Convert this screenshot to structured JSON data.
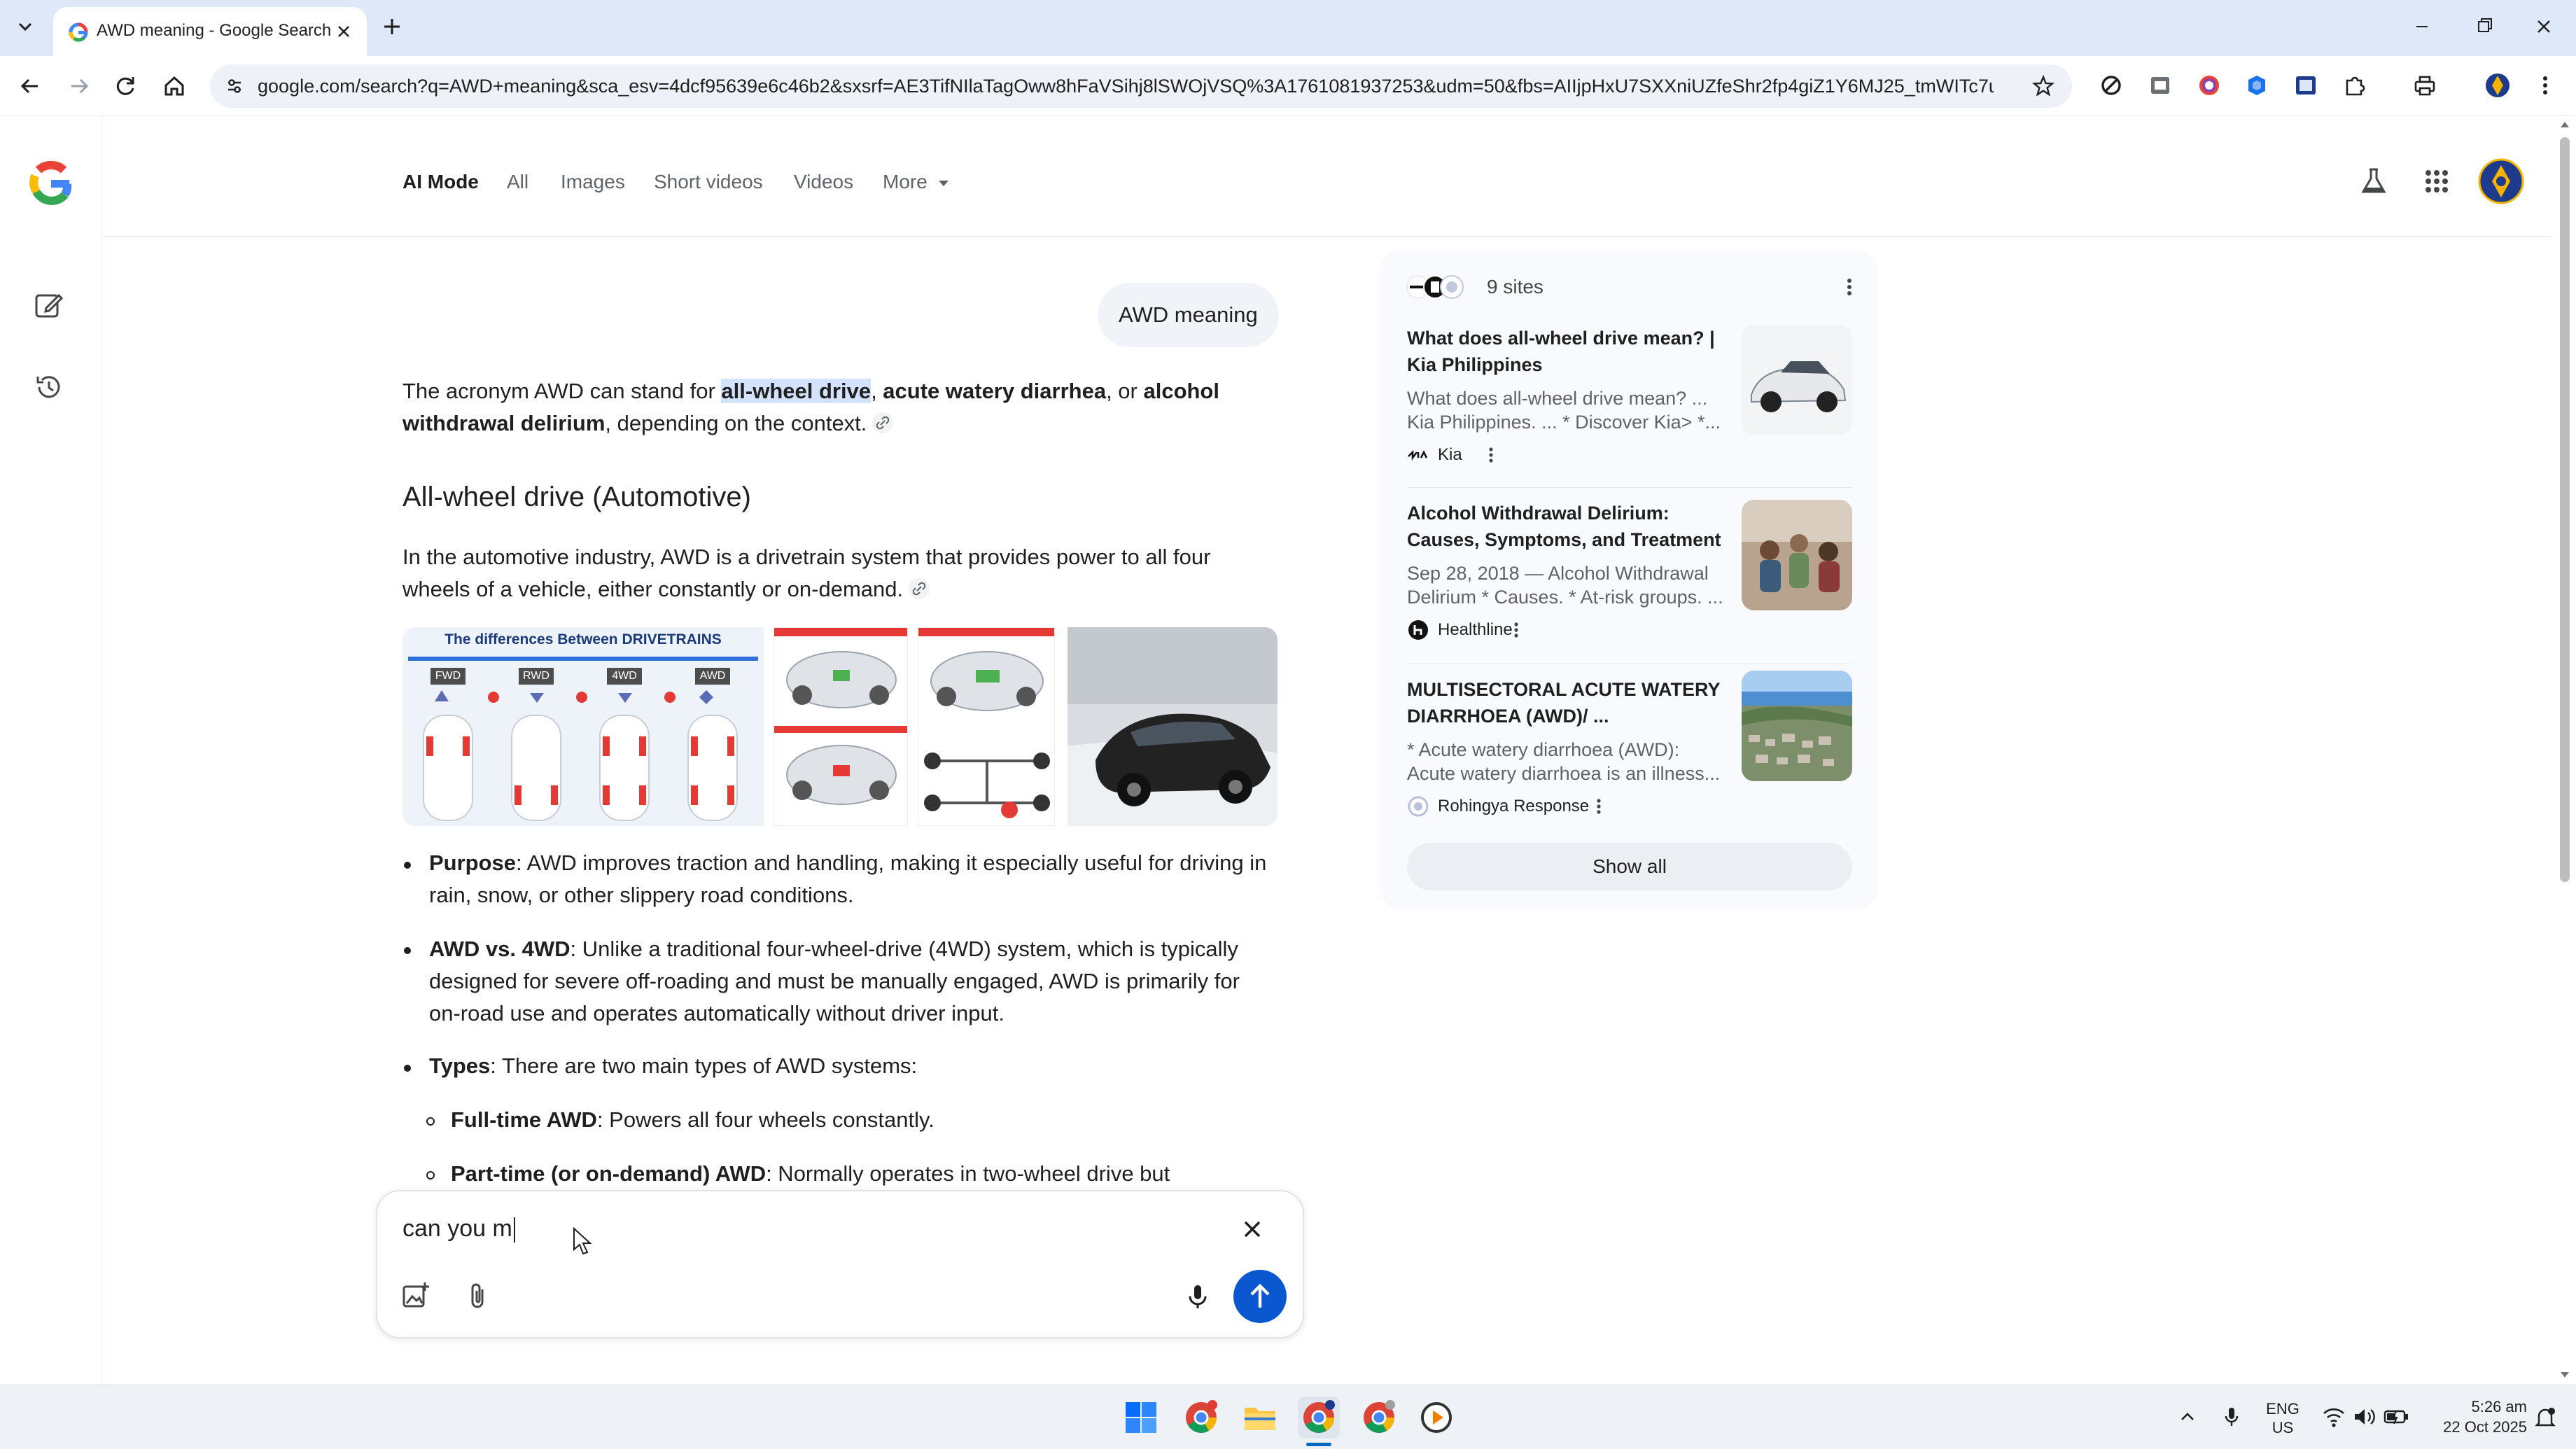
{
  "browser": {
    "tab_title": "AWD meaning - Google Search",
    "url": "google.com/search?q=AWD+meaning&sca_esv=4dcf95639e6c46b2&sxsrf=AE3TifNIlaTagOww8hFaVSihj8lSWOjVSQ%3A1761081937253&udm=50&fbs=AIIjpHxU7SXXniUZfeShr2fp4giZ1Y6MJ25_tmWITc7uy4Kle..."
  },
  "google_nav": {
    "items": [
      "AI Mode",
      "All",
      "Images",
      "Short videos",
      "Videos",
      "More"
    ],
    "active": "AI Mode"
  },
  "answer": {
    "query": "AWD meaning",
    "intro": {
      "p1": "The acronym AWD can stand for ",
      "h1": "all-wheel drive",
      "p2": ", ",
      "b1": "acute watery diarrhea",
      "p3": ", or ",
      "b2a": "alcohol",
      "b2b": "withdrawal delirium",
      "p4": ", depending on the context."
    },
    "heading": "All-wheel drive (Automotive)",
    "para_line1": "In the automotive industry, AWD is a drivetrain system that provides power to all four",
    "para_line2": "wheels of a vehicle, either constantly or on-demand.",
    "image_caption_top": "The differences Between DRIVETRAINS",
    "image_labels": [
      "FWD",
      "RWD",
      "4WD",
      "AWD"
    ],
    "bullets": {
      "purpose_label": "Purpose",
      "purpose_line1": ": AWD improves traction and handling, making it especially useful for driving in",
      "purpose_line2": "rain, snow, or other slippery road conditions.",
      "vs_label": "AWD vs. 4WD",
      "vs_line1": ": Unlike a traditional four-wheel-drive (4WD) system, which is typically",
      "vs_line2": "designed for severe off-roading and must be manually engaged, AWD is primarily for",
      "vs_line3": "on-road use and operates automatically without driver input.",
      "types_label": "Types",
      "types_text": ": There are two main types of AWD systems:",
      "fulltime_label": "Full-time AWD",
      "fulltime_text": ": Powers all four wheels constantly.",
      "parttime_label": "Part-time (or on-demand) AWD",
      "parttime_text": ": Normally operates in two-wheel drive but"
    }
  },
  "input": {
    "value": "can you m"
  },
  "sources": {
    "count_label": "9 sites",
    "items": [
      {
        "title_line1": "What does all-wheel drive mean? |",
        "title_line2": "Kia Philippines",
        "snippet_line1": "What does all-wheel drive mean? ...",
        "snippet_line2": "Kia Philippines. ... * Discover Kia> *...",
        "site": "Kia"
      },
      {
        "title_line1": "Alcohol Withdrawal Delirium:",
        "title_line2": "Causes, Symptoms, and Treatment",
        "snippet_line1": "Sep 28, 2018 — Alcohol Withdrawal",
        "snippet_line2": "Delirium * Causes. * At-risk groups. ...",
        "site": "Healthline"
      },
      {
        "title_line1": "MULTISECTORAL ACUTE WATERY",
        "title_line2": "DIARRHOEA (AWD)/ ...",
        "snippet_line1": "* Acute watery diarrhoea (AWD):",
        "snippet_line2": "Acute watery diarrhoea is an illness...",
        "site": "Rohingya Response"
      }
    ],
    "show_all": "Show all"
  },
  "taskbar": {
    "lang_line1": "ENG",
    "lang_line2": "US",
    "time": "5:26 am",
    "date": "22 Oct 2025"
  },
  "colors": {
    "accent": "#0b57d0",
    "highlight": "#d3e3fd",
    "chrome": "#dee8f8"
  }
}
